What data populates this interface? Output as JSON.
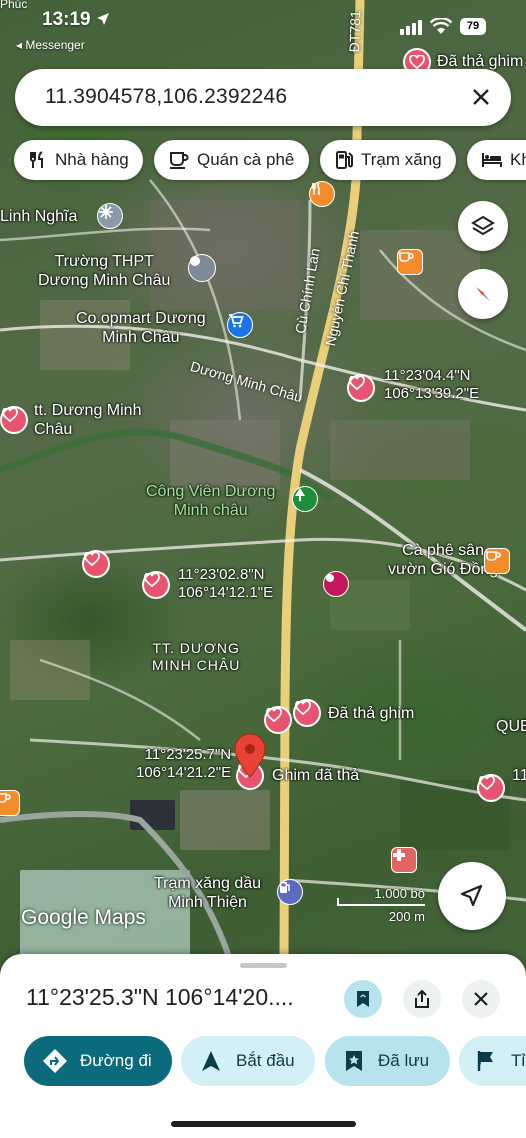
{
  "status_bar": {
    "time": "13:19",
    "back_app": "◂ Messenger",
    "top_left_fragment": "Phúc",
    "battery": "79"
  },
  "search": {
    "query": "11.3904578,106.2392246"
  },
  "chips": [
    {
      "label": "Nhà hàng",
      "icon": "restaurant-icon"
    },
    {
      "label": "Quán cà phê",
      "icon": "coffee-icon"
    },
    {
      "label": "Trạm xăng",
      "icon": "gas-station-icon"
    },
    {
      "label": "Khách sạn",
      "icon": "hotel-icon"
    }
  ],
  "map": {
    "road_labels": {
      "dt781": "ĐT781",
      "cu_chinh_lan": "Cù Chính Lan",
      "nguyen_chi_thanh": "Nguyễn Chí Thanh",
      "duong_minh_chau_road": "Dương Minh Châu"
    },
    "labels": {
      "linh_nghia": "Linh Nghĩa",
      "truong_thpt": "Trường THPT\nDương Minh Châu",
      "coopmart": "Co.opmart Dương\nMinh Châu",
      "tt_duong_minh_chau": "tt. Dương Minh\nChâu",
      "cong_vien": "Công Viên Dương\nMinh châu",
      "ca_phe_san": "Cà phê sân\nvườn Gió Đồng",
      "tt_duong_minh_chau_upper": "TT. DƯƠNG\nMINH CHÂU",
      "tram_xang": "Trạm xăng dầu\nMinh Thiện",
      "pinned_top": "Đã thả ghim",
      "pinned_mid": "Đã thả ghim",
      "pinned_main": "Ghim đã thả",
      "que": "QUE",
      "edge_11": "11"
    },
    "coord_labels": {
      "c1": "11°23'04.4\"N\n106°13'39.2\"E",
      "c2": "11°23'02.8\"N\n106°14'12.1\"E",
      "c3": "11°23'25.7\"N\n106°14'21.2\"E"
    },
    "watermark": "Google Maps",
    "scale": {
      "top": "1.000 bộ",
      "bottom": "200 m"
    }
  },
  "sheet": {
    "coordinates": "11°23'25.3\"N 106°14'20....",
    "actions": [
      {
        "label": "Đường đi",
        "style": "primary"
      },
      {
        "label": "Bắt đầu",
        "style": "tonal"
      },
      {
        "label": "Đã lưu",
        "style": "tonal-strong"
      },
      {
        "label": "Tỉ",
        "style": "tonal"
      }
    ]
  },
  "colors": {
    "primary": "#0b57d0",
    "teal_primary": "#0b6b7c",
    "tonal": "#d3f0f6",
    "tonal_strong": "#b7e3ee",
    "heart": "#e8546f",
    "pin_red": "#ea4335",
    "road_yellow": "#e9cf7a"
  }
}
